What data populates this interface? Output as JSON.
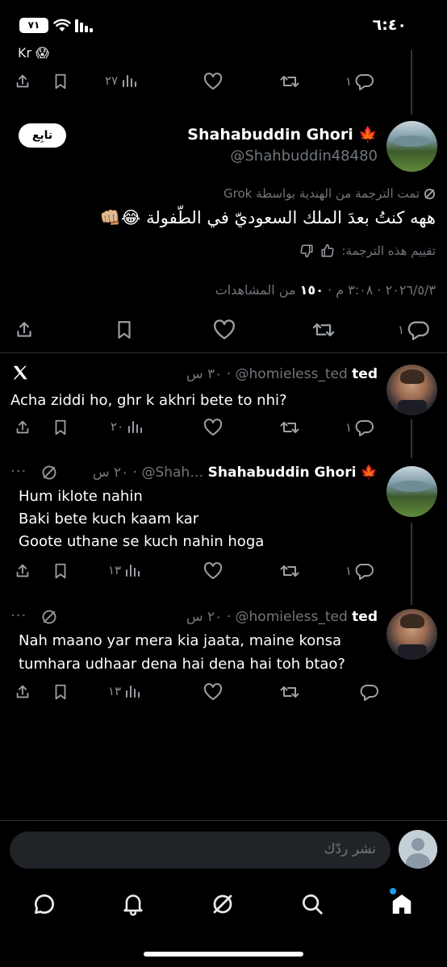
{
  "status_bar": {
    "time": "٦:٤٠",
    "battery": "٧١"
  },
  "colors": {
    "accent": "#1d9bf0",
    "background": "#000000",
    "text": "#e7e9ea",
    "muted": "#71767b",
    "divider": "#2f3336"
  },
  "top_tweet_fragment": {
    "text": "Kr",
    "counts": {
      "reply": "١",
      "views": "٢٧"
    }
  },
  "main_tweet": {
    "author_name": "Shahabuddin Ghori",
    "author_emoji": "🍁",
    "handle": "@Shahbuddin48480",
    "follow_label": "تابِع",
    "translation_note": "تمت الترجمة من الهندية بواسطة Grok",
    "text": "ههه كنتُ بعدَ الملك السعوديّ في الطّفولة 😂👊🏼",
    "rate_label": "تقييم هذه الترجمة:",
    "meta_date": "٢٠٢٦/٥/٣",
    "meta_time": "٣:٠٨ م",
    "meta_views_count": "١٥٠",
    "meta_views_label": "من المشاهدات",
    "counts": {
      "reply": "١"
    }
  },
  "replies": [
    {
      "name": "ted",
      "handle": "@homieless_ted",
      "time": "٣٠ س",
      "lines": [
        "Acha ziddi ho, ghr k akhri bete to nhi?"
      ],
      "counts": {
        "reply": "١",
        "views": "٢٠"
      },
      "has_x_logo": true
    },
    {
      "name": "Shahabuddin Ghori",
      "emoji": "🍁",
      "handle": "@Shah…",
      "time": "٢٠ س",
      "lines": [
        "Hum iklote nahin",
        "Baki bete kuch kaam kar",
        "Goote uthane se kuch nahin hoga"
      ],
      "counts": {
        "reply": "١",
        "views": "١٣"
      }
    },
    {
      "name": "ted",
      "handle": "@homieless_ted",
      "time": "٢٠ س",
      "lines": [
        "Nah maano yar mera kia jaata, maine konsa",
        "tumhara udhaar dena hai dena hai toh btao?"
      ],
      "counts": {
        "reply": "",
        "views": "١٣"
      }
    }
  ],
  "composer": {
    "placeholder": "نشر ردّك"
  },
  "bottom_nav": [
    "home-icon",
    "search-icon",
    "grok-icon",
    "notifications-icon",
    "messages-icon"
  ]
}
